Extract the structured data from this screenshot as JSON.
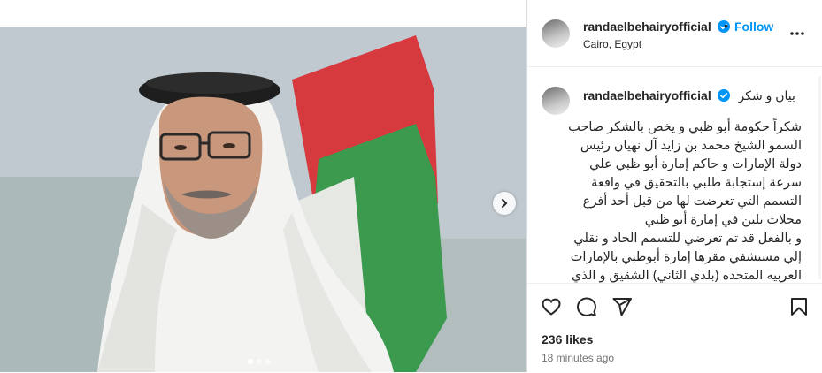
{
  "post": {
    "username": "randaelbehairyofficial",
    "separator": "•",
    "follow_label": "Follow",
    "location": "Cairo, Egypt",
    "likes": "236 likes",
    "time_ago": "18 minutes ago"
  },
  "caption": {
    "username": "randaelbehairyofficial",
    "title": "بيان و شكر",
    "body": "شكراً حكومة أبو ظبي و يخص بالشكر صاحب\nالسمو الشيخ محمد بن زايد آل نهيان رئيس\nدولة الإمارات و حاكم إمارة أبو ظبي علي\nسرعة إستجابة طلبي بالتحقيق في واقعة\nالتسمم التي تعرضت لها من قبل أحد أفرع\nمحلات بلبن في إمارة أبو ظبي\nو بالفعل قد تم تعرضي للتسمم الحاد و نقلي\nإلي مستشفي مقرها إمارة أبوظبي بالإمارات\nالعربيه المتحده (بلدي الثاني) الشقيق و الذي\nطالما إهتم بشئون الإنسان و كرمة و الذي"
  },
  "carousel": {
    "dots": 3,
    "active_dot": 0
  },
  "colors": {
    "follow": "#0095f6",
    "verified": "#0095f6",
    "text": "#262626",
    "muted": "#737373"
  },
  "icons": {
    "like": "heart-icon",
    "comment": "comment-icon",
    "share": "paper-plane-icon",
    "save": "bookmark-icon",
    "more": "more-horizontal-icon",
    "next": "chevron-right-icon"
  }
}
